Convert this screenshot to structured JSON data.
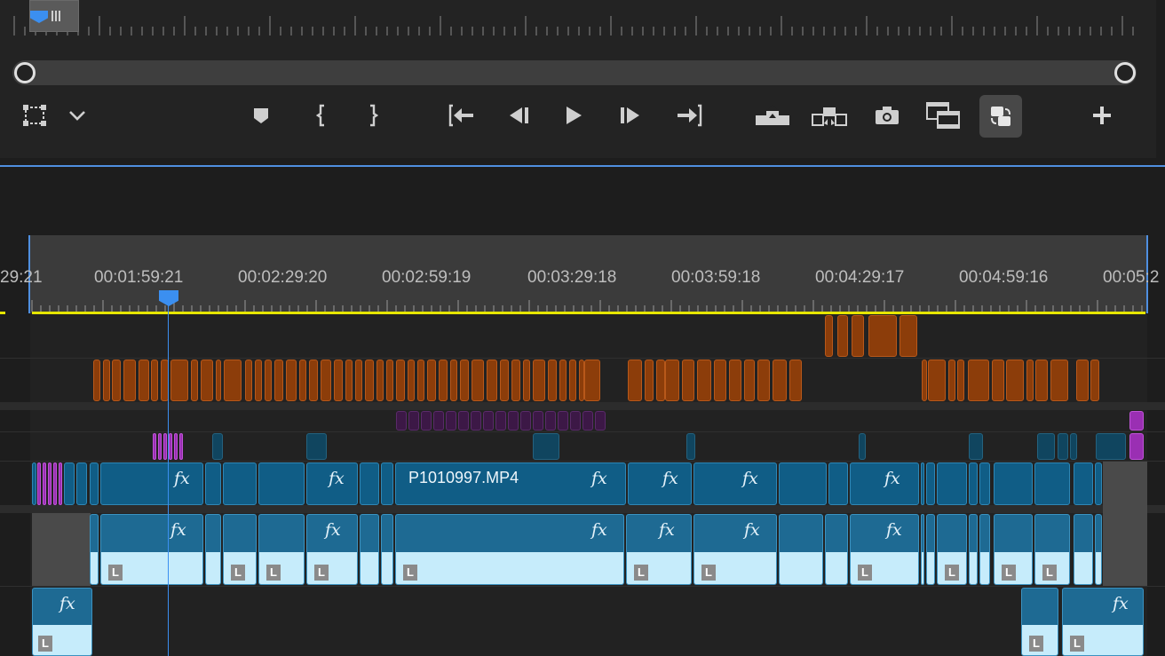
{
  "monitor": {
    "controls": {
      "safe_margins": "safe-margins-icon",
      "settings": "chevron-down-icon",
      "add_marker": "marker-icon",
      "mark_in": "mark-in-icon",
      "mark_out": "mark-out-icon",
      "go_to_in": "go-to-in-icon",
      "step_back": "step-back-icon",
      "play": "play-icon",
      "step_forward": "step-forward-icon",
      "go_to_out": "go-to-out-icon",
      "lift": "lift-icon",
      "extract": "extract-icon",
      "export_frame": "camera-icon",
      "comparison_view": "comparison-view-icon",
      "toggle_proxies": "toggle-proxies-icon",
      "button_editor": "plus-icon"
    }
  },
  "timeline": {
    "timecodes": [
      "29:21",
      "00:01:59:21",
      "00:02:29:20",
      "00:02:59:19",
      "00:03:29:18",
      "00:03:59:18",
      "00:04:29:17",
      "00:04:59:16",
      "00:05:2"
    ],
    "clip_name": "P1010997.MP4",
    "fx_label": "fx",
    "audio_label": "L",
    "colors": {
      "playhead": "#3b8ff0",
      "work_area": "#e6e600",
      "caption_clip": "#8c3d0a",
      "video_clip": "#105d86",
      "audio_waveform": "#c6ecfb"
    }
  }
}
